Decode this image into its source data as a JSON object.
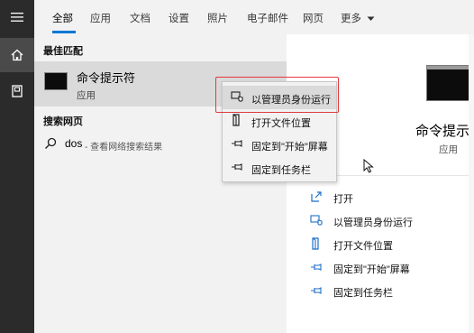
{
  "tabs": {
    "items": [
      {
        "label": "全部"
      },
      {
        "label": "应用"
      },
      {
        "label": "文档"
      },
      {
        "label": "设置"
      },
      {
        "label": "照片"
      },
      {
        "label": "电子邮件"
      },
      {
        "label": "网页"
      },
      {
        "label": "更多"
      }
    ]
  },
  "rail": {
    "icons": [
      "hamburger-menu-icon",
      "home-icon",
      "notebook-icon"
    ]
  },
  "results": {
    "best_match_heading": "最佳匹配",
    "best_match": {
      "title": "命令提示符",
      "subtitle": "应用"
    },
    "web_heading": "搜索网页",
    "web_result": {
      "query": "dos",
      "hint": "- 查看网络搜索结果"
    }
  },
  "context_menu": {
    "items": [
      {
        "label": "以管理员身份运行",
        "icon": "shield-run-icon"
      },
      {
        "label": "打开文件位置",
        "icon": "file-location-icon"
      },
      {
        "label": "固定到\"开始\"屏幕",
        "icon": "pin-icon"
      },
      {
        "label": "固定到任务栏",
        "icon": "pin-icon"
      }
    ],
    "highlight_color": "#e0393e"
  },
  "preview": {
    "title": "命令提示符",
    "subtitle": "应用",
    "actions": [
      {
        "label": "打开",
        "icon": "open-icon"
      },
      {
        "label": "以管理员身份运行",
        "icon": "shield-run-icon"
      },
      {
        "label": "打开文件位置",
        "icon": "file-location-icon"
      },
      {
        "label": "固定到\"开始\"屏幕",
        "icon": "pin-icon"
      },
      {
        "label": "固定到任务栏",
        "icon": "pin-icon"
      }
    ]
  },
  "colors": {
    "accent": "#0078d7",
    "rail_bg": "#2b2b2b",
    "selected_bg": "#dadada"
  }
}
